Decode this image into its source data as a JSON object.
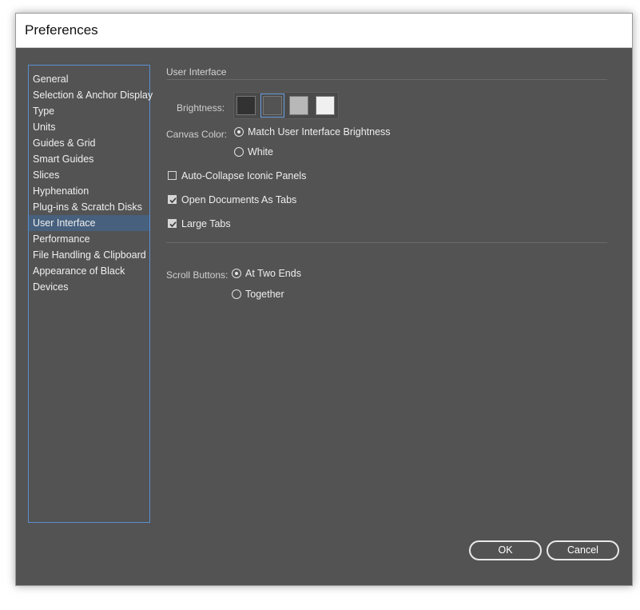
{
  "window": {
    "title": "Preferences"
  },
  "sidebar": {
    "items": [
      {
        "label": "General"
      },
      {
        "label": "Selection & Anchor Display"
      },
      {
        "label": "Type"
      },
      {
        "label": "Units"
      },
      {
        "label": "Guides & Grid"
      },
      {
        "label": "Smart Guides"
      },
      {
        "label": "Slices"
      },
      {
        "label": "Hyphenation"
      },
      {
        "label": "Plug-ins & Scratch Disks"
      },
      {
        "label": "User Interface",
        "selected": true
      },
      {
        "label": "Performance"
      },
      {
        "label": "File Handling & Clipboard"
      },
      {
        "label": "Appearance of Black"
      },
      {
        "label": "Devices"
      }
    ]
  },
  "section": {
    "title": "User Interface",
    "brightness_label": "Brightness:",
    "brightness_swatches": [
      "#323232",
      "#535353",
      "#b8b8b8",
      "#f0f0f0"
    ],
    "brightness_selected_index": 1,
    "canvas_color_label": "Canvas Color:",
    "canvas_color_options": [
      {
        "label": "Match User Interface Brightness",
        "checked": true
      },
      {
        "label": "White",
        "checked": false
      }
    ],
    "checkboxes": [
      {
        "label": "Auto-Collapse Iconic Panels",
        "checked": false
      },
      {
        "label": "Open Documents As Tabs",
        "checked": true
      },
      {
        "label": "Large Tabs",
        "checked": true
      }
    ],
    "scroll_buttons_label": "Scroll Buttons:",
    "scroll_buttons_options": [
      {
        "label": "At Two Ends",
        "checked": true
      },
      {
        "label": "Together",
        "checked": false
      }
    ]
  },
  "buttons": {
    "ok": "OK",
    "cancel": "Cancel"
  }
}
